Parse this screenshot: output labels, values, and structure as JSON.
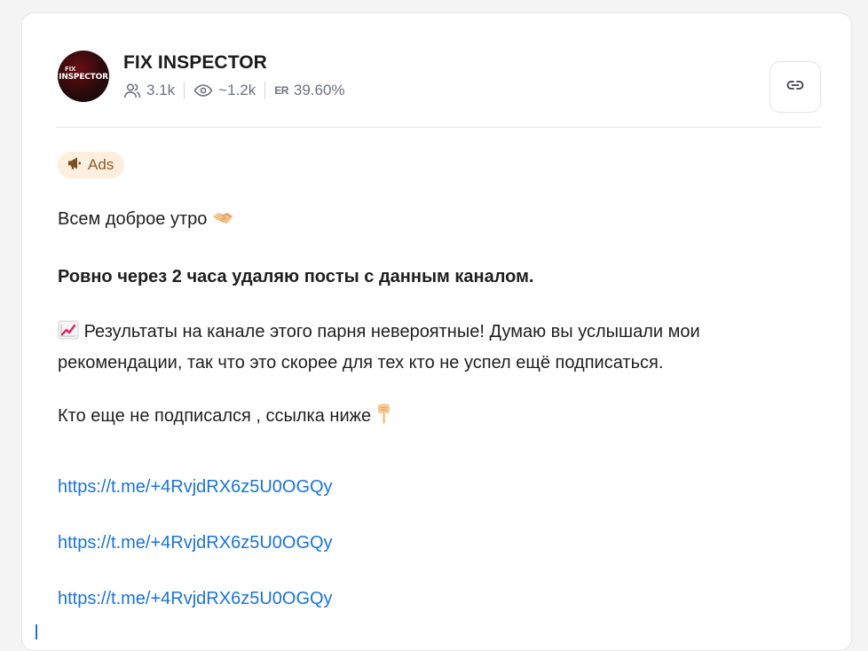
{
  "channel": {
    "name": "FIX INSPECTOR",
    "avatar_text_top": "FIX",
    "avatar_text_main": "INSPECTOR",
    "subscribers": "3.1k",
    "views": "~1.2k",
    "er_label": "ER",
    "er_value": "39.60%"
  },
  "badge": {
    "label": "Ads",
    "icon": "megaphone-icon"
  },
  "post": {
    "greeting": "Всем доброе утро",
    "bold_line": "Ровно через 2 часа удаляю посты с данным каналом.",
    "results": "Результаты на канале этого парня невероятные! Думаю вы услышали мои рекомендации, так что это скорее для тех кто не успел ещё подписаться.",
    "who": "Кто еще не подписался , ссылка ниже",
    "links": [
      "https://t.me/+4RvjdRX6z5U0OGQy",
      "https://t.me/+4RvjdRX6z5U0OGQy",
      "https://t.me/+4RvjdRX6z5U0OGQy"
    ]
  },
  "colors": {
    "link": "#1a73d9",
    "badge_bg": "#fdeedd",
    "badge_text": "#8a5a2b"
  }
}
